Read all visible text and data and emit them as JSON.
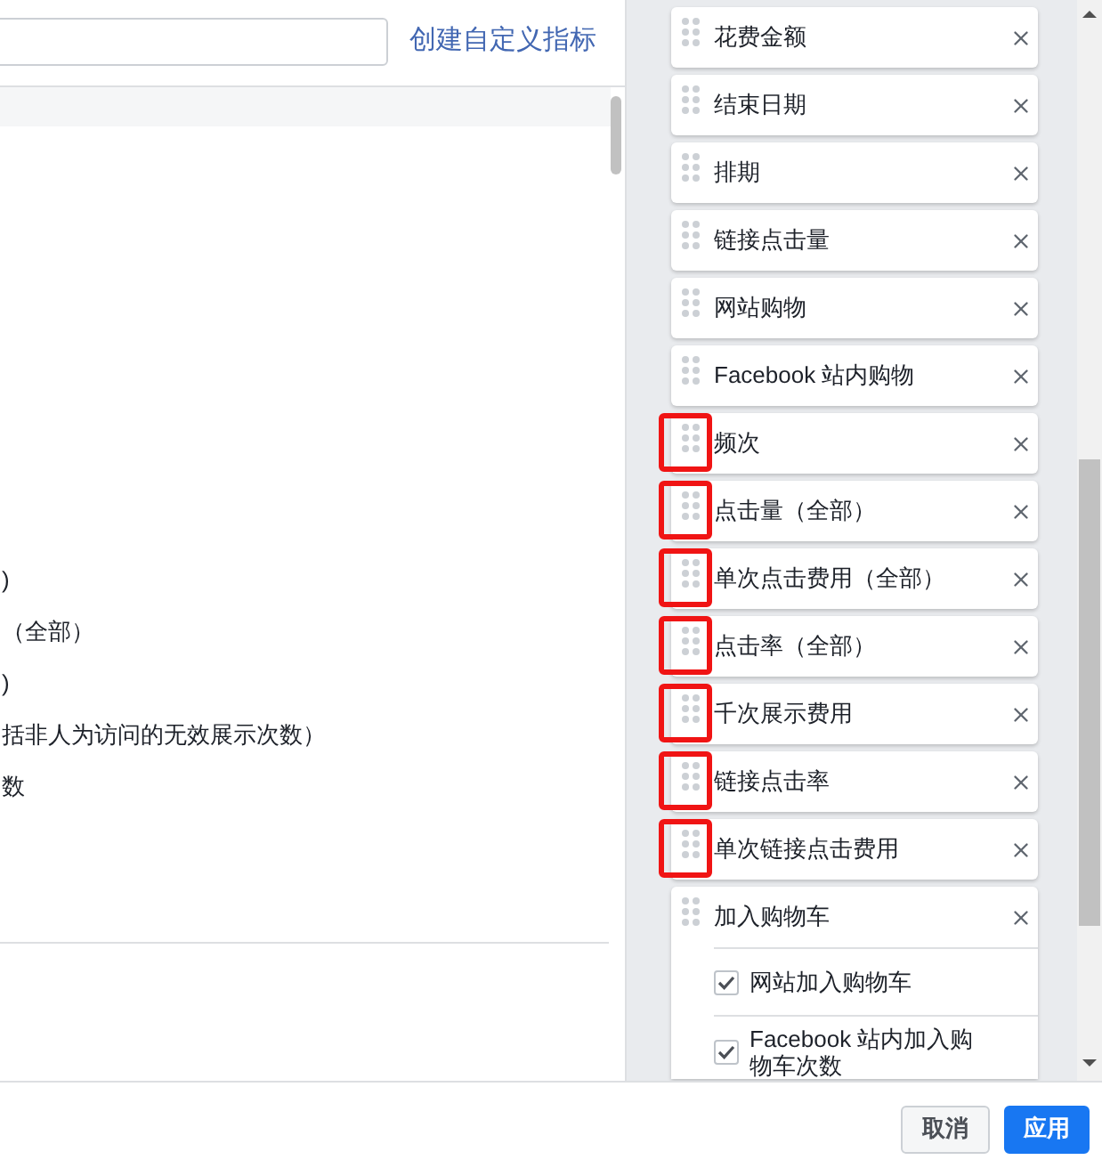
{
  "header": {
    "create_link": "创建自定义指标"
  },
  "metrics_list": {
    "items": [
      ")",
      "（全部）",
      ")",
      "括非人为访问的无效展示次数）",
      "数"
    ]
  },
  "selected_columns": [
    {
      "label": "花费金额",
      "highlighted": false
    },
    {
      "label": "结束日期",
      "highlighted": false
    },
    {
      "label": "排期",
      "highlighted": false
    },
    {
      "label": "链接点击量",
      "highlighted": false
    },
    {
      "label": "网站购物",
      "highlighted": false
    },
    {
      "label": "Facebook 站内购物",
      "highlighted": false
    },
    {
      "label": "频次",
      "highlighted": true
    },
    {
      "label": "点击量（全部）",
      "highlighted": true
    },
    {
      "label": "单次点击费用（全部）",
      "highlighted": true
    },
    {
      "label": "点击率（全部）",
      "highlighted": true
    },
    {
      "label": "千次展示费用",
      "highlighted": true
    },
    {
      "label": "链接点击率",
      "highlighted": true
    },
    {
      "label": "单次链接点击费用",
      "highlighted": true
    },
    {
      "label": "加入购物车",
      "highlighted": false,
      "children": [
        {
          "label": "网站加入购物车",
          "checked": true
        },
        {
          "label": "Facebook 站内加入购物车次数",
          "checked": true
        }
      ]
    }
  ],
  "footer": {
    "buttons": [
      {
        "label": "取消",
        "kind": "secondary"
      },
      {
        "label": "应用",
        "kind": "primary"
      }
    ]
  }
}
